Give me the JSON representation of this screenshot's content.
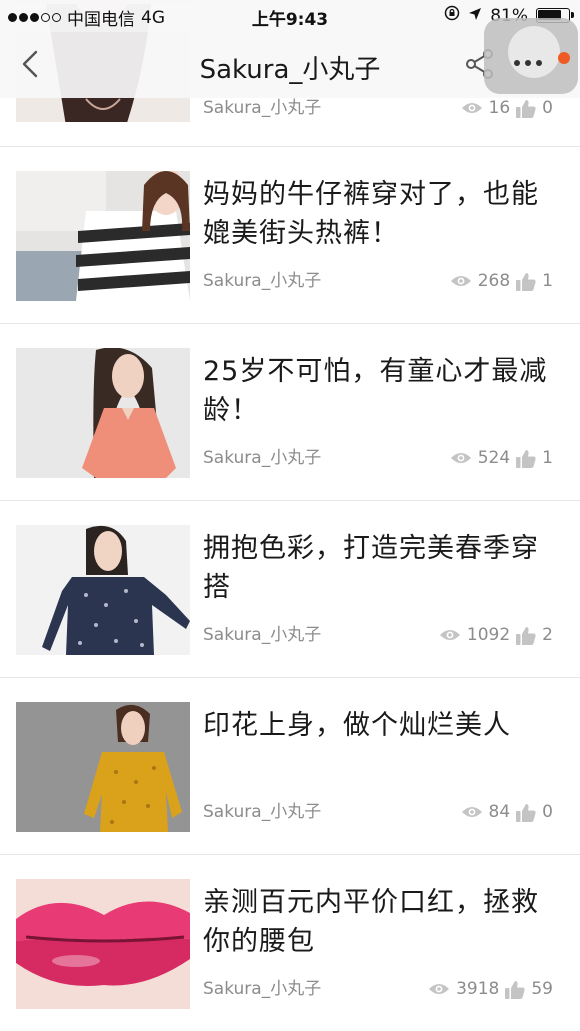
{
  "status_bar": {
    "carrier": "中国电信",
    "network": "4G",
    "time": "上午9:43",
    "battery": "81%",
    "battery_level": 0.81
  },
  "nav": {
    "title": "Sakura_小丸子"
  },
  "partial_item": {
    "author": "Sakura_小丸子",
    "views": "16",
    "likes": "0"
  },
  "articles": [
    {
      "title": "妈妈的牛仔裤穿对了，也能媲美街头热裤！",
      "author": "Sakura_小丸子",
      "views": "268",
      "likes": "1"
    },
    {
      "title": "25岁不可怕，有童心才最减龄！",
      "author": "Sakura_小丸子",
      "views": "524",
      "likes": "1"
    },
    {
      "title": "拥抱色彩，打造完美春季穿搭",
      "author": "Sakura_小丸子",
      "views": "1092",
      "likes": "2"
    },
    {
      "title": "印花上身，做个灿烂美人",
      "author": "Sakura_小丸子",
      "views": "84",
      "likes": "0"
    },
    {
      "title": "亲测百元内平价口红，拯救你的腰包",
      "author": "Sakura_小丸子",
      "views": "3918",
      "likes": "59"
    }
  ],
  "colors": {
    "accent_badge": "#ee5a24",
    "meta_text": "#8c8c8c",
    "divider": "#e6e6e6"
  }
}
